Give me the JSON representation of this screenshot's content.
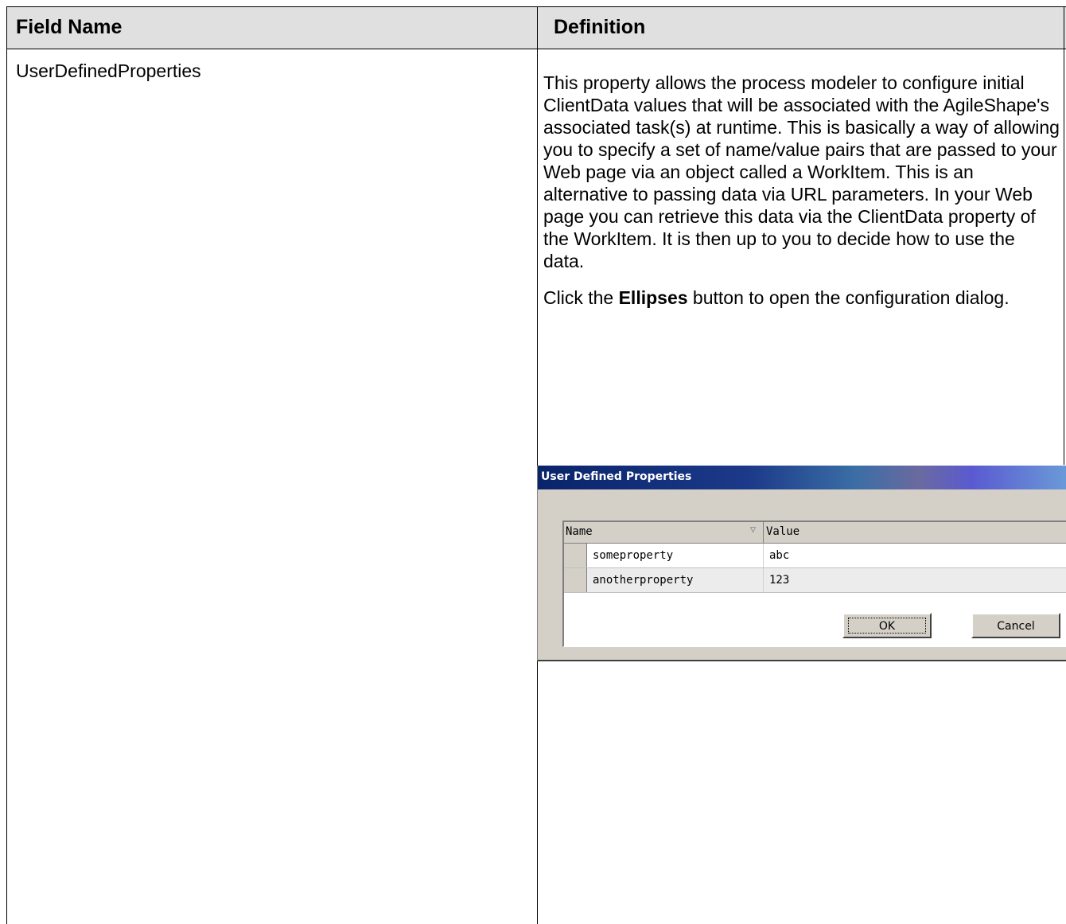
{
  "table": {
    "headers": {
      "field_name": "Field Name",
      "definition": "Definition"
    },
    "rows": [
      {
        "field_name": "UserDefinedProperties",
        "definition_paragraph_1": "This property allows the process modeler to configure initial ClientData values that will be associated with the AgileShape's associated task(s) at runtime. This is basically a way of allowing you to specify a set of name/value pairs that are passed to your Web page via an object called a WorkItem. This is an alternative to passing data via URL parameters. In your Web page you can retrieve this data via the ClientData property of the WorkItem. It is then up to you to decide how to use the data.",
        "definition_paragraph_2_prefix": "Click the ",
        "definition_paragraph_2_bold": "Ellipses",
        "definition_paragraph_2_suffix": " button to open the configuration dialog."
      }
    ]
  },
  "dialog": {
    "title": "User Defined Properties",
    "grid": {
      "columns": [
        "Name",
        "Value"
      ],
      "sort_indicator": "▽",
      "rows": [
        {
          "name": "someproperty",
          "value": "abc"
        },
        {
          "name": "anotherproperty",
          "value": "123"
        }
      ]
    },
    "buttons": {
      "ok": "OK",
      "cancel": "Cancel"
    }
  }
}
